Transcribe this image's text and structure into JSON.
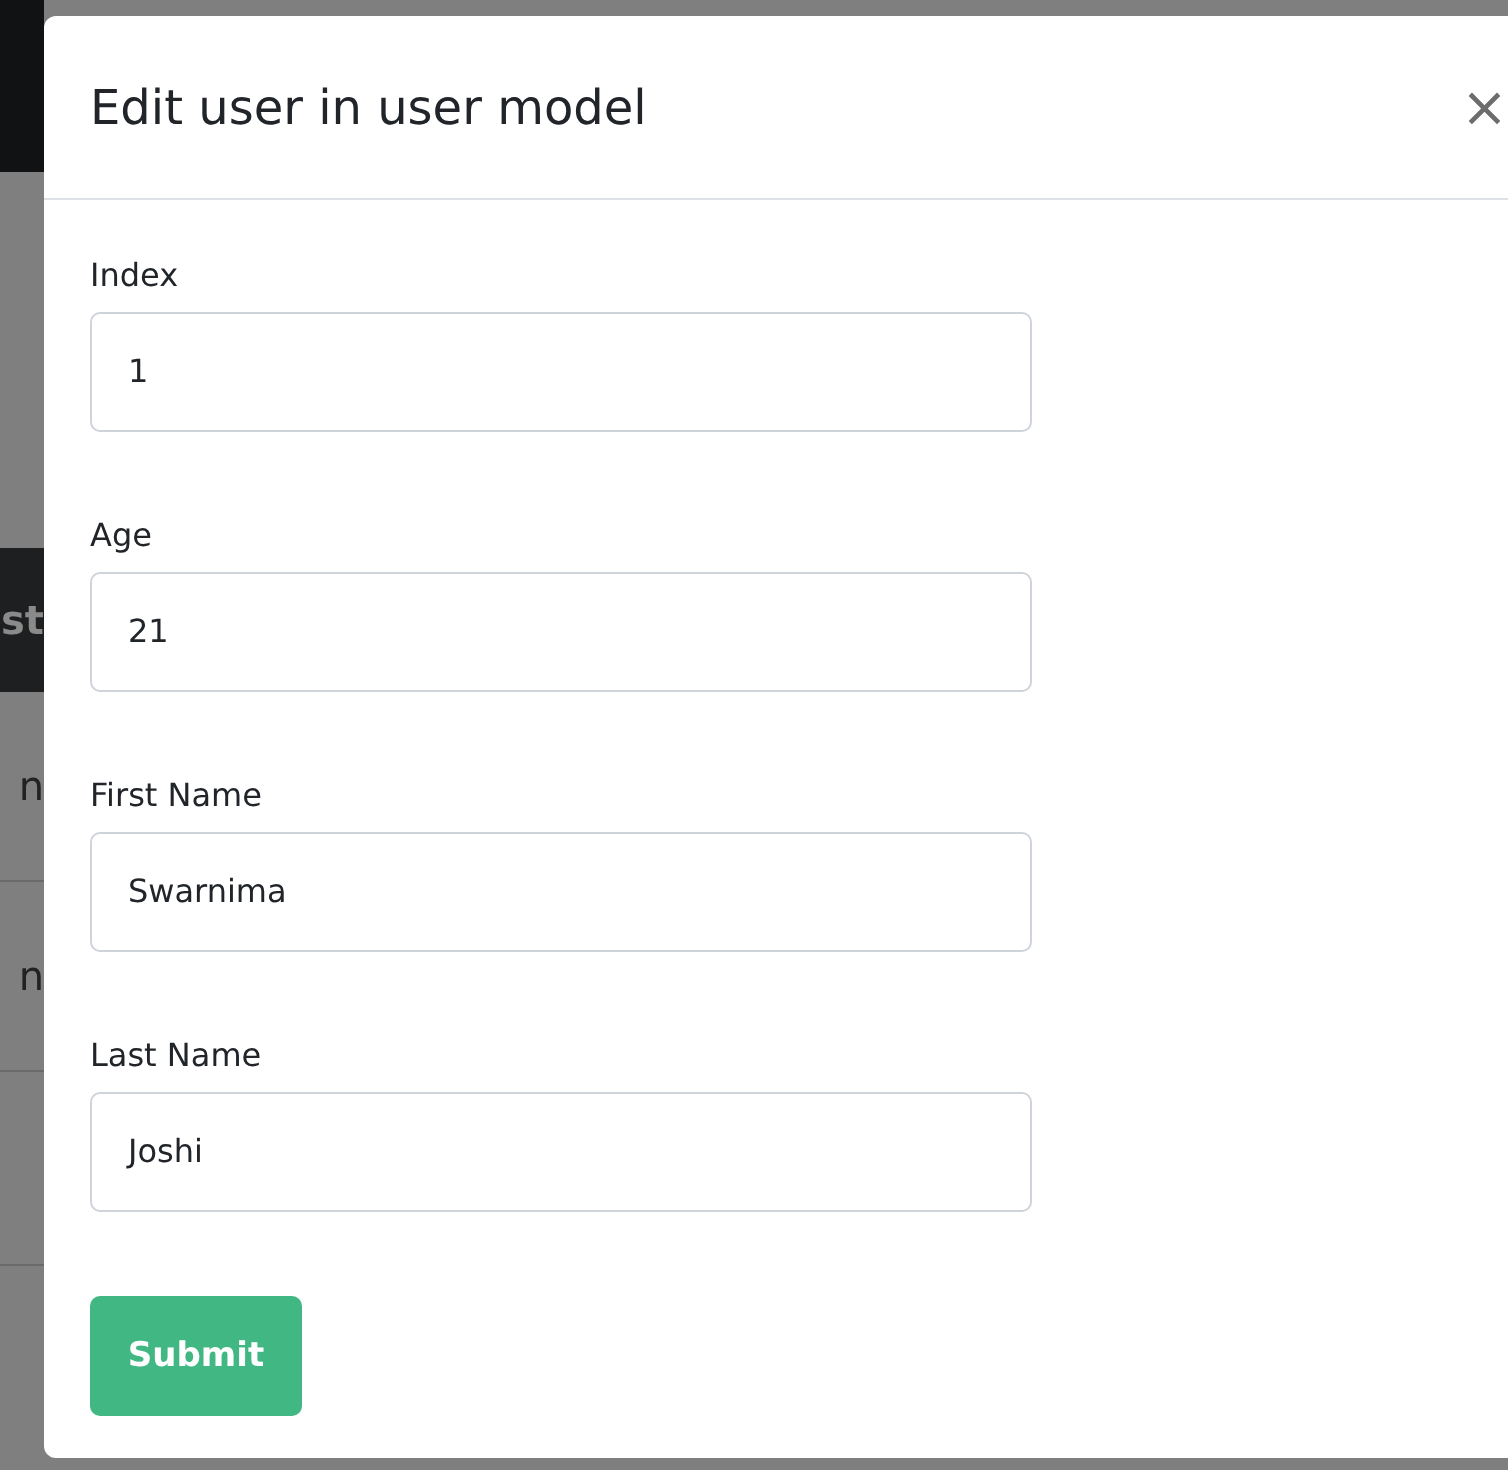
{
  "background": {
    "table_header": "st",
    "rows": [
      "n",
      "n"
    ]
  },
  "modal": {
    "title": "Edit user in user model",
    "close": "×",
    "fields": [
      {
        "label": "Index",
        "value": "1"
      },
      {
        "label": "Age",
        "value": "21"
      },
      {
        "label": "First Name",
        "value": "Swarnima"
      },
      {
        "label": "Last Name",
        "value": "Joshi"
      }
    ],
    "submit": "Submit"
  }
}
